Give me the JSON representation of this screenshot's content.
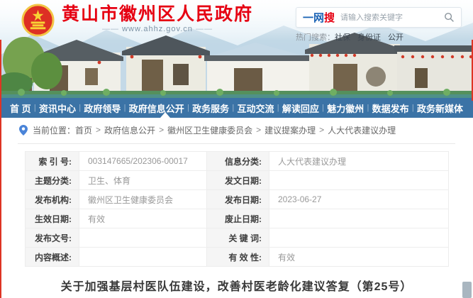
{
  "colors": {
    "accent_red": "#e60012",
    "nav_blue": "#3b73a6",
    "edge_red": "#de3424"
  },
  "header": {
    "site_name": "黄山市徽州区人民政府",
    "site_url": "www.ahhz.gov.cn",
    "url_dash": "——",
    "emblem_icon": "national-emblem-icon",
    "search": {
      "brand_blue": "一网",
      "brand_red": "搜",
      "placeholder": "请输入搜索关键字",
      "icon": "search-icon"
    },
    "hot": {
      "label": "热门搜索：",
      "tags": [
        "社保",
        "身份证",
        "公开"
      ]
    }
  },
  "nav": {
    "separator": "|",
    "active_item": "政府信息公开",
    "items": [
      "首 页",
      "资讯中心",
      "政府领导",
      "政府信息公开",
      "政务服务",
      "互动交流",
      "解读回应",
      "魅力徽州",
      "数据发布",
      "政务新媒体"
    ]
  },
  "breadcrumb": {
    "prefix": "当前位置：",
    "separator": ">",
    "items": [
      "首页",
      "政府信息公开",
      "徽州区卫生健康委员会",
      "建议提案办理",
      "人大代表建议办理"
    ]
  },
  "infotable": {
    "rows": [
      {
        "l1": "索 引 号:",
        "v1": "003147665/202306-00017",
        "l2": "信息分类:",
        "v2": "人大代表建议办理"
      },
      {
        "l1": "主题分类:",
        "v1": "卫生、体育",
        "l2": "发文日期:",
        "v2": ""
      },
      {
        "l1": "发布机构:",
        "v1": "徽州区卫生健康委员会",
        "l2": "发布日期:",
        "v2": "2023-06-27"
      },
      {
        "l1": "生效日期:",
        "v1": "有效",
        "l2": "废止日期:",
        "v2": ""
      },
      {
        "l1": "发布文号:",
        "v1": "",
        "l2": "关 键 词:",
        "v2": ""
      },
      {
        "l1": "内容概述:",
        "v1": "",
        "l2": "有 效 性:",
        "v2": "有效"
      }
    ]
  },
  "doc_title": "关于加强基层村医队伍建设，改善村医老龄化建议答复（第25号）"
}
